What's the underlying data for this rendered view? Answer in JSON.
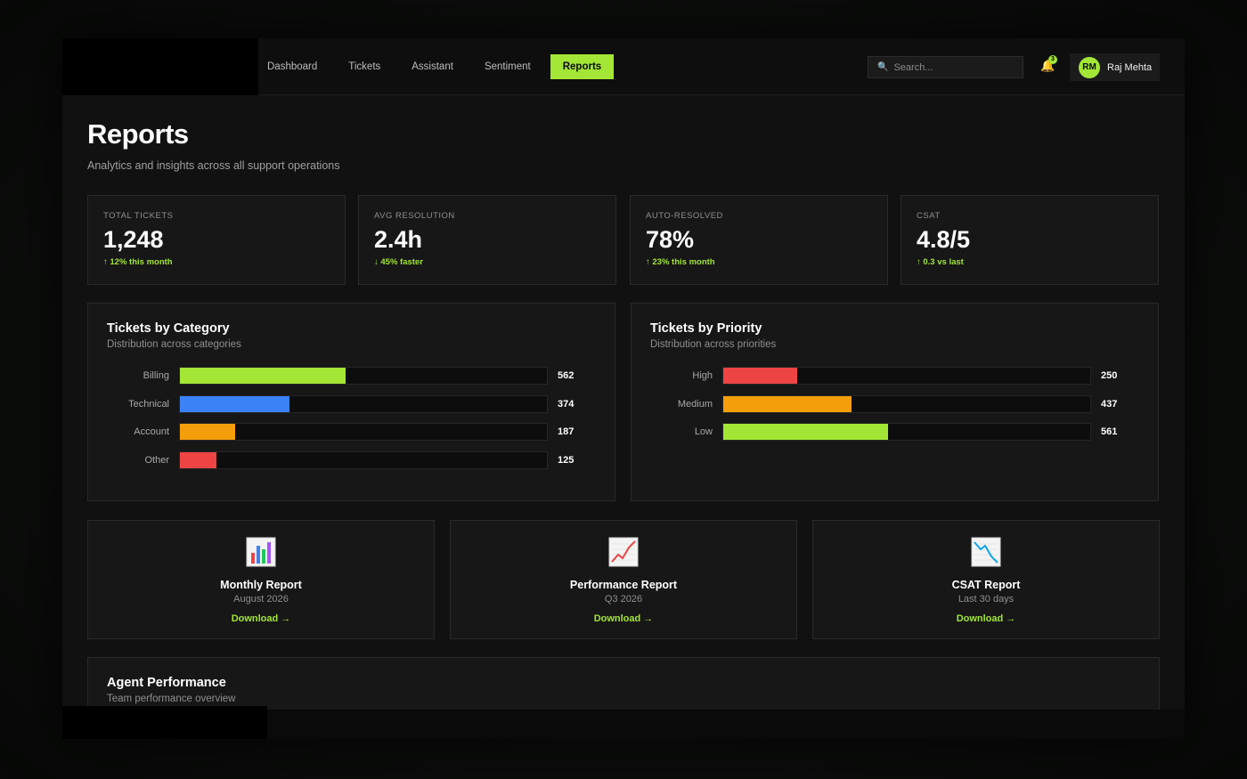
{
  "nav": {
    "items": [
      {
        "label": "Dashboard"
      },
      {
        "label": "Tickets"
      },
      {
        "label": "Assistant"
      },
      {
        "label": "Sentiment"
      },
      {
        "label": "Reports",
        "active": true
      }
    ]
  },
  "search": {
    "placeholder": "Search..."
  },
  "notifications": {
    "count": "3"
  },
  "user": {
    "initials": "RM",
    "name": "Raj Mehta"
  },
  "page": {
    "title": "Reports",
    "subtitle": "Analytics and insights across all support operations"
  },
  "stats": [
    {
      "label": "TOTAL TICKETS",
      "value": "1,248",
      "delta": "↑ 12% this month"
    },
    {
      "label": "AVG RESOLUTION",
      "value": "2.4h",
      "delta": "↓ 45% faster"
    },
    {
      "label": "AUTO-RESOLVED",
      "value": "78%",
      "delta": "↑ 23% this month"
    },
    {
      "label": "CSAT",
      "value": "4.8/5",
      "delta": "↑ 0.3 vs last"
    }
  ],
  "category_panel": {
    "title": "Tickets by Category",
    "subtitle": "Distribution across categories"
  },
  "priority_panel": {
    "title": "Tickets by Priority",
    "subtitle": "Distribution across priorities"
  },
  "chart_data": [
    {
      "type": "bar",
      "title": "Tickets by Category",
      "subtitle": "Distribution across categories",
      "categories": [
        "Billing",
        "Technical",
        "Account",
        "Other"
      ],
      "values": [
        562,
        374,
        187,
        125
      ],
      "colors": [
        "#a3e635",
        "#3b82f6",
        "#f59e0b",
        "#ef4444"
      ],
      "max": 1248
    },
    {
      "type": "bar",
      "title": "Tickets by Priority",
      "subtitle": "Distribution across priorities",
      "categories": [
        "High",
        "Medium",
        "Low"
      ],
      "values": [
        250,
        437,
        561
      ],
      "colors": [
        "#ef4444",
        "#f59e0b",
        "#a3e635"
      ],
      "max": 1248
    }
  ],
  "reports": [
    {
      "icon": "bar-chart-icon",
      "title": "Monthly Report",
      "sub": "August 2026",
      "link": "Download →"
    },
    {
      "icon": "trend-up-icon",
      "title": "Performance Report",
      "sub": "Q3 2026",
      "link": "Download →"
    },
    {
      "icon": "trend-down-icon",
      "title": "CSAT Report",
      "sub": "Last 30 days",
      "link": "Download →"
    }
  ],
  "agent_panel": {
    "title": "Agent Performance",
    "subtitle": "Team performance overview"
  },
  "colors": {
    "accent": "#a3e635",
    "background": "#111111",
    "card": "#171717"
  }
}
